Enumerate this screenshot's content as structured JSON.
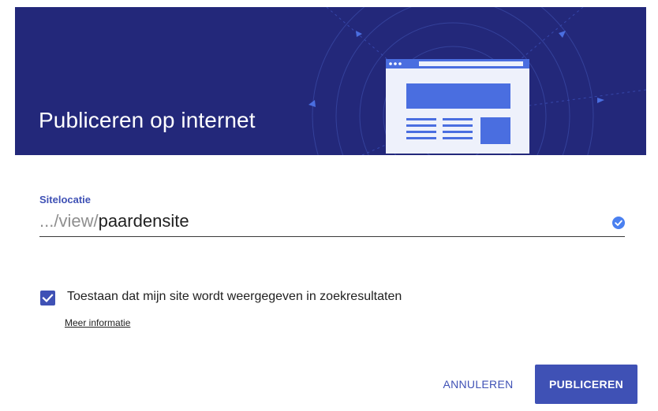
{
  "dialog": {
    "title": "Publiceren op internet",
    "field_label": "Sitelocatie",
    "url_prefix": ".../view/",
    "url_value": "paardensite",
    "checkbox_checked": true,
    "checkbox_label": "Toestaan dat mijn site wordt weergegeven in zoekresultaten",
    "more_info": "Meer informatie",
    "cancel_label": "ANNULEREN",
    "publish_label": "PUBLICEREN"
  },
  "icons": {
    "valid": "check-circle-icon",
    "checkbox": "checkbox-checked-icon",
    "illustration": "website-illustration-icon"
  },
  "colors": {
    "header_bg": "#23287a",
    "accent": "#3f51b5",
    "illustration_blue": "#4a6ee0"
  }
}
